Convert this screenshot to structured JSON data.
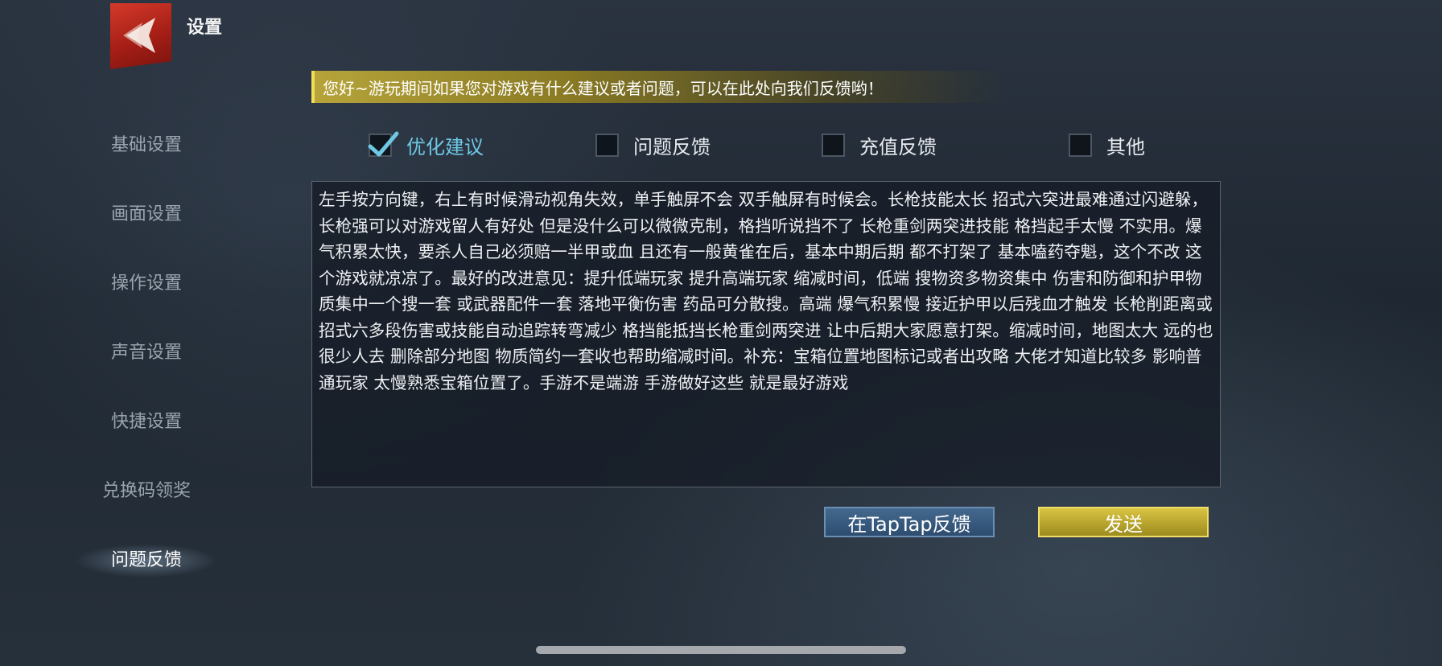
{
  "header": {
    "title": "设置",
    "logo_icon": "back-chevron-icon"
  },
  "notice": "您好~游玩期间如果您对游戏有什么建议或者问题，可以在此处向我们反馈哟！",
  "sidebar": {
    "items": [
      {
        "label": "基础设置",
        "active": false
      },
      {
        "label": "画面设置",
        "active": false
      },
      {
        "label": "操作设置",
        "active": false
      },
      {
        "label": "声音设置",
        "active": false
      },
      {
        "label": "快捷设置",
        "active": false
      },
      {
        "label": "兑换码领奖",
        "active": false
      },
      {
        "label": "问题反馈",
        "active": true
      }
    ]
  },
  "categories": [
    {
      "label": "优化建议",
      "checked": true
    },
    {
      "label": "问题反馈",
      "checked": false
    },
    {
      "label": "充值反馈",
      "checked": false
    },
    {
      "label": "其他",
      "checked": false
    }
  ],
  "feedback_text": "左手按方向键，右上有时候滑动视角失效，单手触屏不会 双手触屏有时候会。长枪技能太长 招式六突进最难通过闪避躲，长枪强可以对游戏留人有好处 但是没什么可以微微克制，格挡听说挡不了 长枪重剑两突进技能 格挡起手太慢 不实用。爆气积累太快，要杀人自己必须赔一半甲或血 且还有一般黄雀在后，基本中期后期 都不打架了 基本嗑药夺魁，这个不改 这个游戏就凉凉了。最好的改进意见：提升低端玩家 提升高端玩家 缩减时间，低端 搜物资多物资集中 伤害和防御和护甲物质集中一个搜一套 或武器配件一套 落地平衡伤害 药品可分散搜。高端 爆气积累慢 接近护甲以后残血才触发 长枪削距离或招式六多段伤害或技能自动追踪转弯减少 格挡能抵挡长枪重剑两突进 让中后期大家愿意打架。缩减时间，地图太大 远的也很少人去 删除部分地图 物质简约一套收也帮助缩减时间。补充：宝箱位置地图标记或者出攻略 大佬才知道比较多 影响普通玩家 太慢熟悉宝箱位置了。手游不是端游 手游做好这些 就是最好游戏",
  "buttons": {
    "taptap": "在TapTap反馈",
    "send": "发送"
  },
  "colors": {
    "accent_checked": "#6ec8e4",
    "send_gold": "#d9c442",
    "taptap_blue": "#44688e",
    "logo_red": "#c5302a"
  }
}
